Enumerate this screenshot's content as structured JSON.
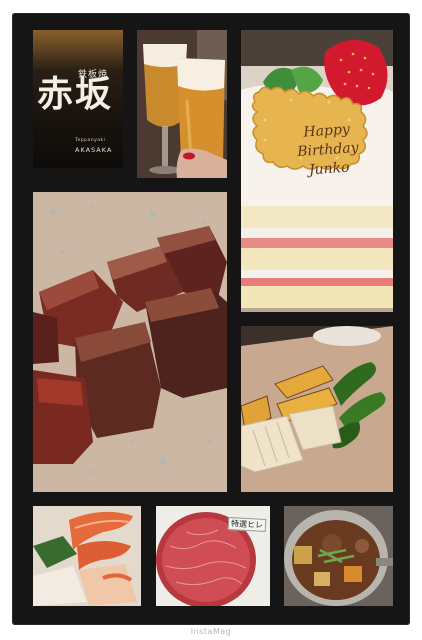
{
  "collage": {
    "sign": {
      "kanji_small": "鉄板焼",
      "kanji_big": "赤坂",
      "romaji_small": "Teppanyaki",
      "romaji": "AKASAKA"
    },
    "cake": {
      "message": "Happy Birthday Junko"
    },
    "fillet_tag": "特選ヒレ"
  },
  "watermark": "InstaMag"
}
